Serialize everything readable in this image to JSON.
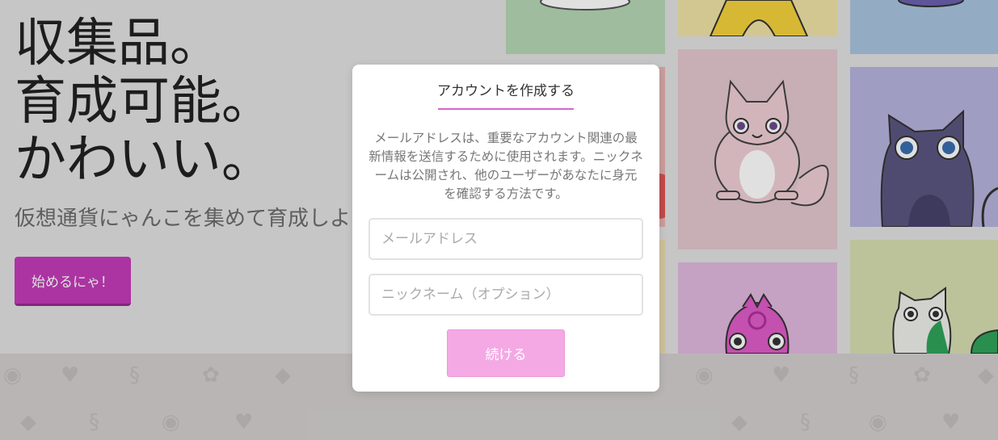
{
  "hero": {
    "headline": [
      "収集品。",
      "育成可能。",
      "かわいい。"
    ],
    "subline": "仮想通貨にゃんこを集めて育成しよう",
    "start_button": "始めるにゃ！"
  },
  "modal": {
    "title": "アカウントを作成する",
    "description": "メールアドレスは、重要なアカウント関連の最新情報を送信するために使用されます。ニックネームは公開され、他のユーザーがあなたに身元を確認する方法です。",
    "email": {
      "value": "",
      "placeholder": "メールアドレス"
    },
    "nickname": {
      "value": "",
      "placeholder": "ニックネーム（オプション）"
    },
    "continue_button": "続ける",
    "accent": "#d566cc"
  },
  "colors": {
    "brand_button": "#c33cb9",
    "continue_button": "#f4a9e5",
    "tile_green": "#b5d7b5",
    "tile_yellow": "#f0e3a6",
    "tile_blue": "#a9c4df",
    "tile_pink": "#e4c6cf",
    "tile_lavender": "#b6b3dc",
    "tile_magenta": "#e1b9de",
    "tile_lightgreen": "#d6dfb1"
  },
  "icons": [
    "cat-illustration",
    "heart-icon",
    "paw-icon",
    "ethereum-icon",
    "dna-icon",
    "yarn-icon"
  ]
}
